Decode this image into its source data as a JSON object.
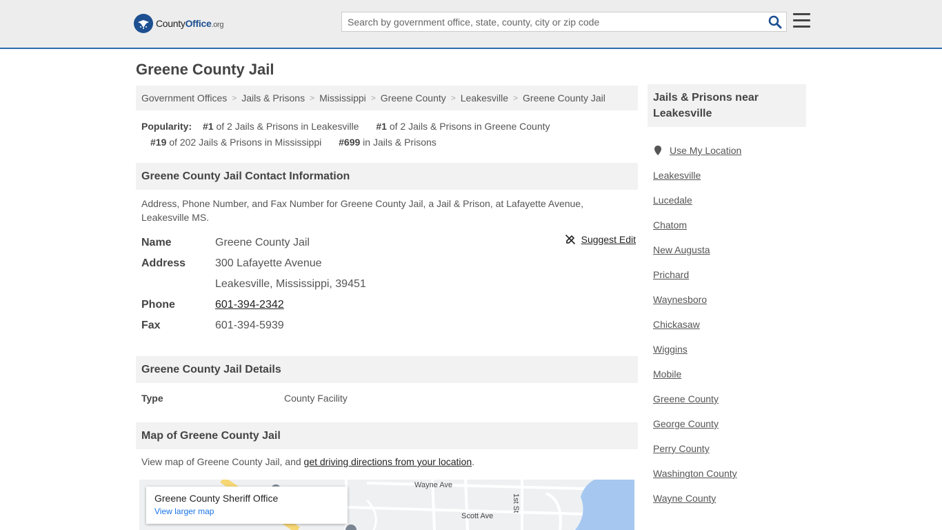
{
  "header": {
    "logo_county": "County",
    "logo_office": "Office",
    "logo_tld": ".org",
    "search_placeholder": "Search by government office, state, county, city or zip code"
  },
  "page_title": "Greene County Jail",
  "breadcrumb": [
    "Government Offices",
    "Jails & Prisons",
    "Mississippi",
    "Greene County",
    "Leakesville",
    "Greene County Jail"
  ],
  "popularity": {
    "label": "Popularity:",
    "items": [
      {
        "rank": "#1",
        "text": " of 2 Jails & Prisons in Leakesville"
      },
      {
        "rank": "#1",
        "text": " of 2 Jails & Prisons in Greene County"
      },
      {
        "rank": "#19",
        "text": " of 202 Jails & Prisons in Mississippi"
      },
      {
        "rank": "#699",
        "text": " in Jails & Prisons"
      }
    ]
  },
  "contact": {
    "heading": "Greene County Jail Contact Information",
    "description": "Address, Phone Number, and Fax Number for Greene County Jail, a Jail & Prison, at Lafayette Avenue, Leakesville MS.",
    "suggest_edit": "Suggest Edit",
    "name_label": "Name",
    "name": "Greene County Jail",
    "address_label": "Address",
    "address_line1": "300 Lafayette Avenue",
    "address_line2": "Leakesville, Mississippi, 39451",
    "phone_label": "Phone",
    "phone": "601-394-2342",
    "fax_label": "Fax",
    "fax": "601-394-5939"
  },
  "details": {
    "heading": "Greene County Jail Details",
    "type_label": "Type",
    "type_value": "County Facility"
  },
  "map_section": {
    "heading": "Map of Greene County Jail",
    "desc_prefix": "View map of Greene County Jail, and ",
    "desc_link": "get driving directions from your location",
    "desc_suffix": ".",
    "card_title": "Greene County Sheriff Office",
    "card_link": "View larger map",
    "streets": [
      "Wayne Ave",
      "Scott Ave",
      "1st St"
    ]
  },
  "sidebar": {
    "heading": "Jails & Prisons near Leakesville",
    "use_location": "Use My Location",
    "items": [
      "Leakesville",
      "Lucedale",
      "Chatom",
      "New Augusta",
      "Prichard",
      "Waynesboro",
      "Chickasaw",
      "Wiggins",
      "Mobile",
      "Greene County",
      "George County",
      "Perry County",
      "Washington County",
      "Wayne County"
    ]
  }
}
